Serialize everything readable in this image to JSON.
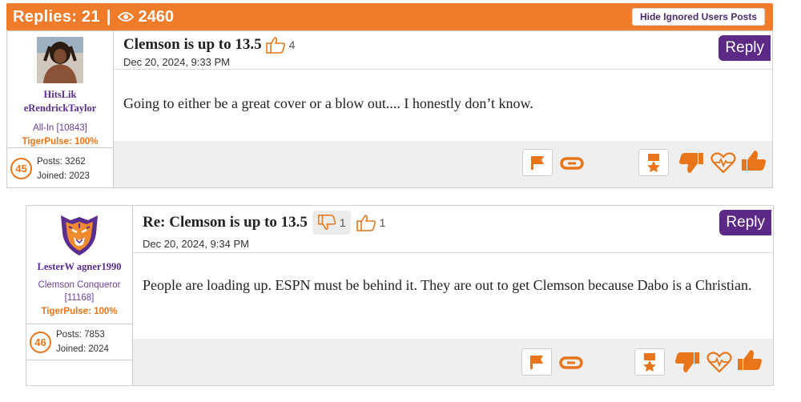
{
  "topbar": {
    "replies_label": "Replies: 21",
    "separator": "|",
    "views": "2460",
    "hide_button": "Hide Ignored Users Posts"
  },
  "colors": {
    "orange": "#ef7c2a",
    "purple": "#5c2a86"
  },
  "posts": [
    {
      "username_line1": "HitsLik",
      "username_line2": "eRendrickTaylor",
      "rank": "All-In [10843]",
      "tigerpulse": "TigerPulse: 100%",
      "level": "45",
      "posts": "Posts: 3262",
      "joined": "Joined: 2023",
      "title": "Clemson is up to 13.5",
      "upvotes": "4",
      "date": "Dec 20, 2024, 9:33 PM",
      "reply_label": "Reply",
      "body": "Going to either be a great cover or a blow out.... I honestly don’t know."
    },
    {
      "username_line1": "LesterW agner1990",
      "rank_line1": "Clemson Conqueror",
      "rank_line2": "[11168]",
      "tigerpulse": "TigerPulse: 100%",
      "level": "46",
      "posts": "Posts: 7853",
      "joined": "Joined: 2024",
      "title": "Re: Clemson is up to 13.5",
      "downvotes": "1",
      "upvotes": "1",
      "date": "Dec 20, 2024, 9:34 PM",
      "reply_label": "Reply",
      "body": "People are loading up. ESPN must be behind it. They are out to get Clemson because Dabo is a Christian."
    }
  ],
  "icons": [
    "eye-icon",
    "thumbs-up-outline-icon",
    "thumbs-down-outline-icon",
    "flag-icon",
    "link-icon",
    "medal-icon",
    "thumbs-down-icon",
    "heart-pulse-icon",
    "thumbs-up-icon",
    "tiger-avatar"
  ]
}
